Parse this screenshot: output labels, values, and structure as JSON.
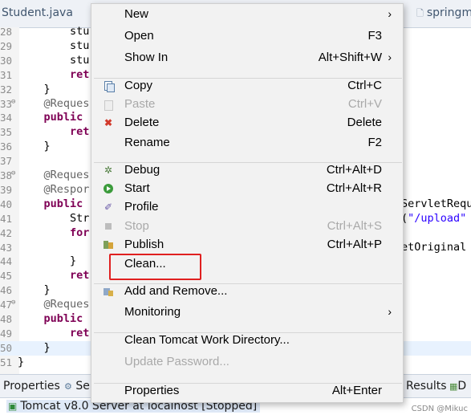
{
  "editor": {
    "tab_left": "Student.java",
    "tab_right": "springm",
    "lines": [
      {
        "num": "28",
        "text": "        stu",
        "fold": "",
        "hl": false
      },
      {
        "num": "29",
        "text": "        stu",
        "fold": "",
        "hl": false
      },
      {
        "num": "30",
        "text": "        stu",
        "fold": "",
        "hl": false
      },
      {
        "num": "31",
        "text": "        ret",
        "fold": "",
        "hl": false
      },
      {
        "num": "32",
        "text": "    }",
        "fold": "",
        "hl": false
      },
      {
        "num": "33",
        "text": "    @Reques",
        "fold": "⊖",
        "hl": false
      },
      {
        "num": "34",
        "text": "    public ",
        "fold": "",
        "hl": false
      },
      {
        "num": "35",
        "text": "        ret",
        "fold": "",
        "hl": false
      },
      {
        "num": "36",
        "text": "    }",
        "fold": "",
        "hl": false
      },
      {
        "num": "37",
        "text": "",
        "fold": "",
        "hl": false
      },
      {
        "num": "38",
        "text": "    @Reques",
        "fold": "⊖",
        "hl": false
      },
      {
        "num": "39",
        "text": "    @Respor",
        "fold": "",
        "hl": false
      },
      {
        "num": "40",
        "text": "    public ",
        "fold": "",
        "hl": false
      },
      {
        "num": "41",
        "text": "        Str",
        "fold": "",
        "hl": false
      },
      {
        "num": "42",
        "text": "        for",
        "fold": "",
        "hl": false
      },
      {
        "num": "43",
        "text": "",
        "fold": "",
        "hl": false
      },
      {
        "num": "44",
        "text": "        }",
        "fold": "",
        "hl": false
      },
      {
        "num": "45",
        "text": "        ret",
        "fold": "",
        "hl": false
      },
      {
        "num": "46",
        "text": "    }",
        "fold": "",
        "hl": false
      },
      {
        "num": "47",
        "text": "    @Reques",
        "fold": "⊖",
        "hl": false
      },
      {
        "num": "48",
        "text": "    public ",
        "fold": "",
        "hl": false
      },
      {
        "num": "49",
        "text": "        ret",
        "fold": "",
        "hl": false
      },
      {
        "num": "50",
        "text": "    }",
        "fold": "",
        "hl": true
      },
      {
        "num": "51",
        "text": "}",
        "fold": "",
        "hl": false
      }
    ],
    "right_fragments": {
      "line40": "ServletRequ",
      "line41_pre": "(",
      "line41_str": "\"/upload\"",
      "line43": "etOriginal"
    }
  },
  "bottom_panel": {
    "tab_properties": "Properties",
    "tab_servers": "Se",
    "tab_results": "Results",
    "tab_extra": "D",
    "server_row": "Tomcat v8.0 Server at localhost  [Stopped]",
    "watermark": "CSDN @Mikuc"
  },
  "context_menu": {
    "items": [
      {
        "label": "New",
        "accel": "",
        "submenu": true,
        "disabled": false,
        "icon": ""
      },
      {
        "label": "Open",
        "accel": "F3",
        "submenu": false,
        "disabled": false,
        "icon": ""
      },
      {
        "label": "Show In",
        "accel": "Alt+Shift+W",
        "submenu": true,
        "disabled": false,
        "icon": ""
      },
      {
        "label": "Copy",
        "accel": "Ctrl+C",
        "submenu": false,
        "disabled": false,
        "icon": "copy-icon"
      },
      {
        "label": "Paste",
        "accel": "Ctrl+V",
        "submenu": false,
        "disabled": true,
        "icon": "paste-icon"
      },
      {
        "label": "Delete",
        "accel": "Delete",
        "submenu": false,
        "disabled": false,
        "icon": "delete-icon"
      },
      {
        "label": "Rename",
        "accel": "F2",
        "submenu": false,
        "disabled": false,
        "icon": ""
      },
      {
        "label": "Debug",
        "accel": "Ctrl+Alt+D",
        "submenu": false,
        "disabled": false,
        "icon": "debug-icon"
      },
      {
        "label": "Start",
        "accel": "Ctrl+Alt+R",
        "submenu": false,
        "disabled": false,
        "icon": "start-icon"
      },
      {
        "label": "Profile",
        "accel": "",
        "submenu": false,
        "disabled": false,
        "icon": "profile-icon"
      },
      {
        "label": "Stop",
        "accel": "Ctrl+Alt+S",
        "submenu": false,
        "disabled": true,
        "icon": "stop-icon"
      },
      {
        "label": "Publish",
        "accel": "Ctrl+Alt+P",
        "submenu": false,
        "disabled": false,
        "icon": "publish-icon"
      },
      {
        "label": "Clean...",
        "accel": "",
        "submenu": false,
        "disabled": false,
        "icon": ""
      },
      {
        "label": "Add and Remove...",
        "accel": "",
        "submenu": false,
        "disabled": false,
        "icon": "add-remove-icon"
      },
      {
        "label": "Monitoring",
        "accel": "",
        "submenu": true,
        "disabled": false,
        "icon": ""
      },
      {
        "label": "Clean Tomcat Work Directory...",
        "accel": "",
        "submenu": false,
        "disabled": false,
        "icon": ""
      },
      {
        "label": "Update Password...",
        "accel": "",
        "submenu": false,
        "disabled": true,
        "icon": ""
      },
      {
        "label": "Properties",
        "accel": "Alt+Enter",
        "submenu": false,
        "disabled": false,
        "icon": ""
      }
    ],
    "highlight_color": "#e02020"
  }
}
